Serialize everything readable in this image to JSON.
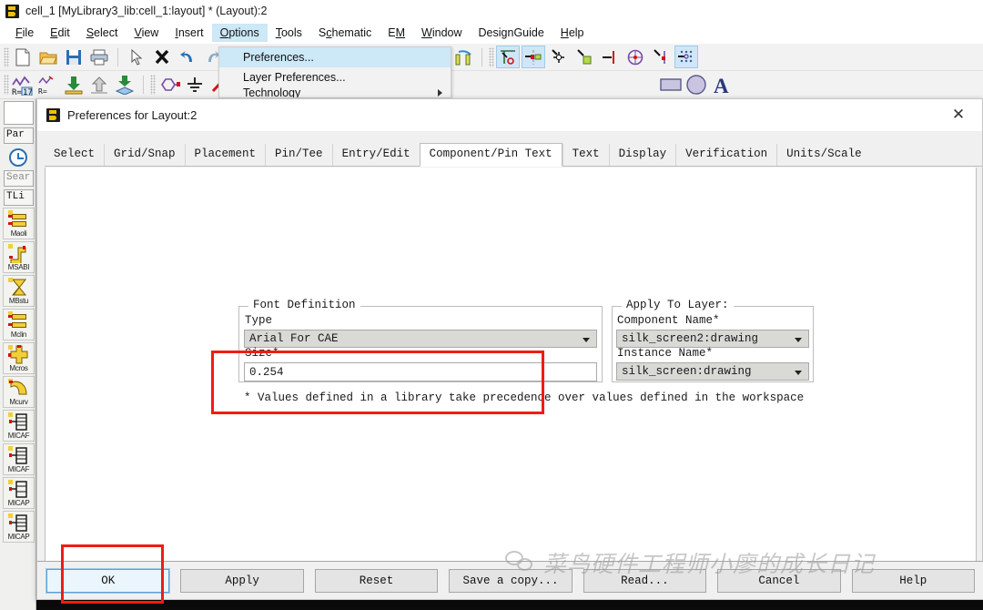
{
  "window": {
    "title": "cell_1 [MyLibrary3_lib:cell_1:layout] * (Layout):2",
    "logo_name": "ads-app-logo"
  },
  "menubar": {
    "items": [
      {
        "label": "File",
        "mnemonic": "F"
      },
      {
        "label": "Edit",
        "mnemonic": "E"
      },
      {
        "label": "Select",
        "mnemonic": "S"
      },
      {
        "label": "View",
        "mnemonic": "V"
      },
      {
        "label": "Insert",
        "mnemonic": "I"
      },
      {
        "label": "Options",
        "mnemonic": "O"
      },
      {
        "label": "Tools",
        "mnemonic": "T"
      },
      {
        "label": "Schematic",
        "mnemonic": "c"
      },
      {
        "label": "EM",
        "mnemonic": "M"
      },
      {
        "label": "Window",
        "mnemonic": "W"
      },
      {
        "label": "DesignGuide",
        "mnemonic": ""
      },
      {
        "label": "Help",
        "mnemonic": "H"
      }
    ],
    "active": "Options"
  },
  "options_menu": {
    "items": [
      {
        "label": "Preferences...",
        "highlighted": true
      },
      {
        "label": "Layer Preferences...",
        "highlighted": false
      },
      {
        "label": "Technology",
        "highlighted": false,
        "submenu": true
      }
    ]
  },
  "toolbar1": {
    "icons": [
      "new-document-icon",
      "open-folder-icon",
      "save-disk-icon",
      "print-icon",
      "pointer-arrow-icon",
      "delete-x-icon",
      "undo-icon",
      "redo-icon"
    ],
    "icons_right": [
      "align-center-vertical-icon",
      "rotate-component-icon",
      "mirror-horizontal-icon",
      "mirror-vertical-icon",
      "snap-origin-icon",
      "snap-pin-icon",
      "snap-vertex-icon",
      "snap-edge-icon",
      "snap-midpoint-icon",
      "snap-center-icon",
      "snap-intersection-icon",
      "snap-grid-icon"
    ]
  },
  "toolbar2": {
    "icons": [
      "optim-cockpit-icon",
      "tune-parameters-icon",
      "download-to-icon",
      "upload-from-icon",
      "layout-sync-icon",
      "port-icon",
      "ground-icon",
      "wire-icon",
      "rectangle-icon",
      "circle-icon",
      "text-icon"
    ]
  },
  "sidebar": {
    "palette_label": "Par",
    "history_icon": "clock-history-icon",
    "search_placeholder": "Sear",
    "library_label": "TLi",
    "items": [
      {
        "label": "Maoli",
        "icon": "mlin-microstrip-icon"
      },
      {
        "label": "MSABI",
        "icon": "msabnd-bend-icon"
      },
      {
        "label": "MBstu",
        "icon": "mbstub-icon"
      },
      {
        "label": "Mclin",
        "icon": "mclin-coupled-icon"
      },
      {
        "label": "Mcros",
        "icon": "mcross-icon"
      },
      {
        "label": "Mcurv",
        "icon": "mcurve-icon"
      },
      {
        "label": "MICAF",
        "icon": "micap-icon"
      },
      {
        "label": "MICAF",
        "icon": "micap-icon"
      },
      {
        "label": "MICAP",
        "icon": "micap-icon"
      },
      {
        "label": "MICAP",
        "icon": "micap-icon"
      }
    ]
  },
  "dialog": {
    "title": "Preferences for Layout:2",
    "close_label": "✕",
    "tabs": [
      {
        "label": "Select",
        "active": false
      },
      {
        "label": "Grid/Snap",
        "active": false
      },
      {
        "label": "Placement",
        "active": false
      },
      {
        "label": "Pin/Tee",
        "active": false
      },
      {
        "label": "Entry/Edit",
        "active": false
      },
      {
        "label": "Component/Pin Text",
        "active": true
      },
      {
        "label": "Text",
        "active": false
      },
      {
        "label": "Display",
        "active": false
      },
      {
        "label": "Verification",
        "active": false
      },
      {
        "label": "Units/Scale",
        "active": false
      }
    ],
    "font_definition": {
      "group_title": "Font Definition",
      "type_label": "Type",
      "type_value": "Arial For CAE",
      "size_label": "Size*",
      "size_value": "0.254"
    },
    "apply_to_layer": {
      "group_title": "Apply To Layer:",
      "component_name_label": "Component Name*",
      "component_name_value": "silk_screen2:drawing",
      "instance_name_label": "Instance Name*",
      "instance_name_value": "silk_screen:drawing"
    },
    "footnote": "* Values defined in a library take precedence over values defined in the workspace",
    "buttons": [
      {
        "label": "OK",
        "default": true
      },
      {
        "label": "Apply",
        "default": false
      },
      {
        "label": "Reset",
        "default": false
      },
      {
        "label": "Save a copy...",
        "default": false
      },
      {
        "label": "Read...",
        "default": false
      },
      {
        "label": "Cancel",
        "default": false
      },
      {
        "label": "Help",
        "default": false
      }
    ]
  },
  "annotations": {
    "color": "#f01c13",
    "count": 2
  },
  "watermark": {
    "text": "菜鸟硬件工程师小廖的成长日记",
    "icon": "wechat-icon"
  }
}
